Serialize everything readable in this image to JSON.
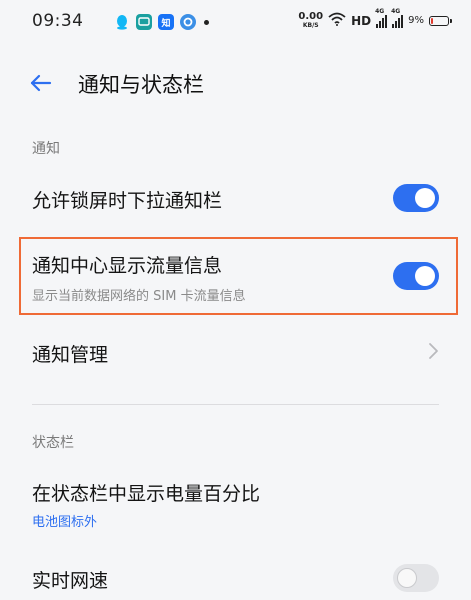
{
  "status_bar": {
    "time": "09:34",
    "app_icons": [
      "qq-icon",
      "message-icon",
      "zhihu-icon",
      "browser-icon"
    ],
    "zhihu_glyph": "知",
    "net_speed_value": "0.00",
    "net_speed_unit": "KB/S",
    "hd_label": "HD",
    "signal_tag_1": "4G",
    "signal_tag_2": "4G",
    "battery_percent": "9%",
    "battery_level": 0.09,
    "battery_color": "#e23b2e"
  },
  "header": {
    "title": "通知与状态栏",
    "back_icon": "back-arrow-icon"
  },
  "sections": {
    "notifications": "通知",
    "statusbar": "状态栏"
  },
  "settings": {
    "lock_pulldown": {
      "label": "允许锁屏时下拉通知栏",
      "enabled": true
    },
    "traffic_info": {
      "label": "通知中心显示流量信息",
      "desc": "显示当前数据网络的 SIM 卡流量信息",
      "enabled": true
    },
    "notif_manage": {
      "label": "通知管理"
    },
    "battery_percent": {
      "label": "在状态栏中显示电量百分比",
      "value": "电池图标外"
    },
    "realtime_speed": {
      "label": "实时网速",
      "enabled": false
    }
  },
  "colors": {
    "accent": "#2d6ff0",
    "highlight_border": "#ef6a36",
    "background": "#f5f6f8"
  }
}
